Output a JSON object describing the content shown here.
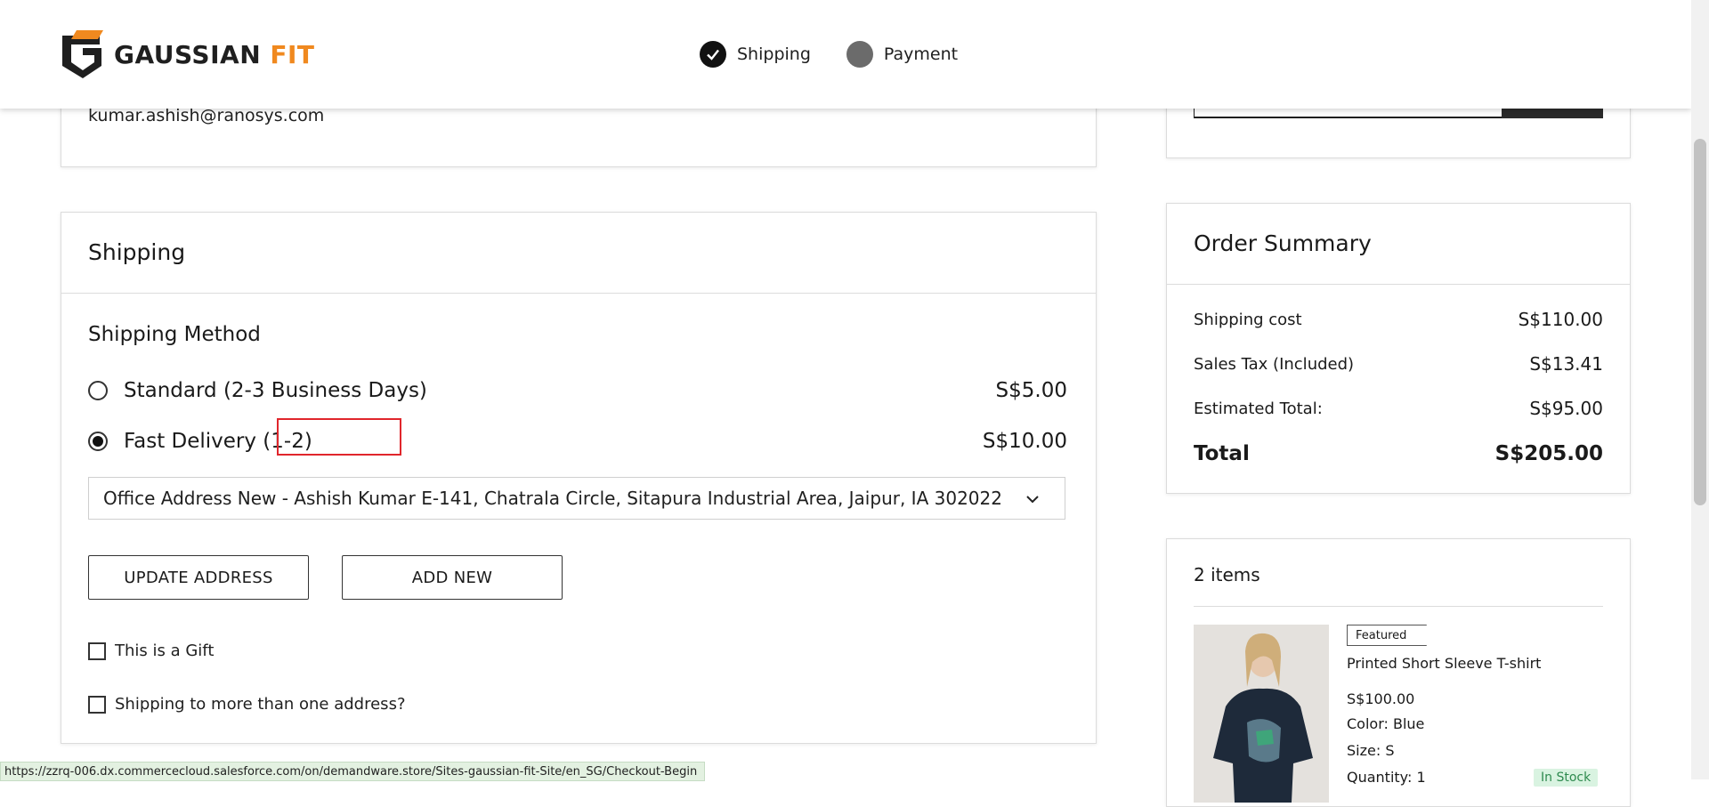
{
  "header": {
    "logo_main": "GAUSSIAN",
    "logo_accent": "FIT",
    "steps": [
      {
        "label": "Shipping",
        "state": "complete"
      },
      {
        "label": "Payment",
        "state": "pending"
      }
    ]
  },
  "contact": {
    "email": "kumar.ashish@ranosys.com"
  },
  "shipping": {
    "title": "Shipping",
    "method_title": "Shipping Method",
    "options": [
      {
        "label": "Standard (2-3 Business Days)",
        "price": "S$5.00",
        "selected": false
      },
      {
        "label": "Fast Delivery (1-2)",
        "price": "S$10.00",
        "selected": true
      }
    ],
    "address_selected": "Office Address New - Ashish Kumar E-141, Chatrala Circle, Sitapura Industrial Area, Jaipur, IA 302022",
    "update_address_label": "UPDATE ADDRESS",
    "add_new_label": "ADD NEW",
    "gift_label": "This is a Gift",
    "multi_address_label": "Shipping to more than one address?"
  },
  "summary": {
    "title": "Order Summary",
    "rows": [
      {
        "label": "Shipping cost",
        "value": "S$110.00"
      },
      {
        "label": "Sales Tax (Included)",
        "value": "S$13.41"
      },
      {
        "label": "Estimated Total:",
        "value": "S$95.00"
      }
    ],
    "total_label": "Total",
    "total_value": "S$205.00"
  },
  "items": {
    "count_label": "2 items",
    "product": {
      "badge": "Featured",
      "name": "Printed Short Sleeve T-shirt",
      "price": "S$100.00",
      "color": "Color: Blue",
      "size": "Size: S",
      "quantity": "Quantity: 1",
      "stock": "In Stock"
    }
  },
  "status_url": "https://zzrq-006.dx.commercecloud.salesforce.com/on/demandware.store/Sites-gaussian-fit-Site/en_SG/Checkout-Begin",
  "colors": {
    "accent": "#f0891f",
    "highlight_box": "#e0262c",
    "in_stock": "#2e8a4f"
  }
}
